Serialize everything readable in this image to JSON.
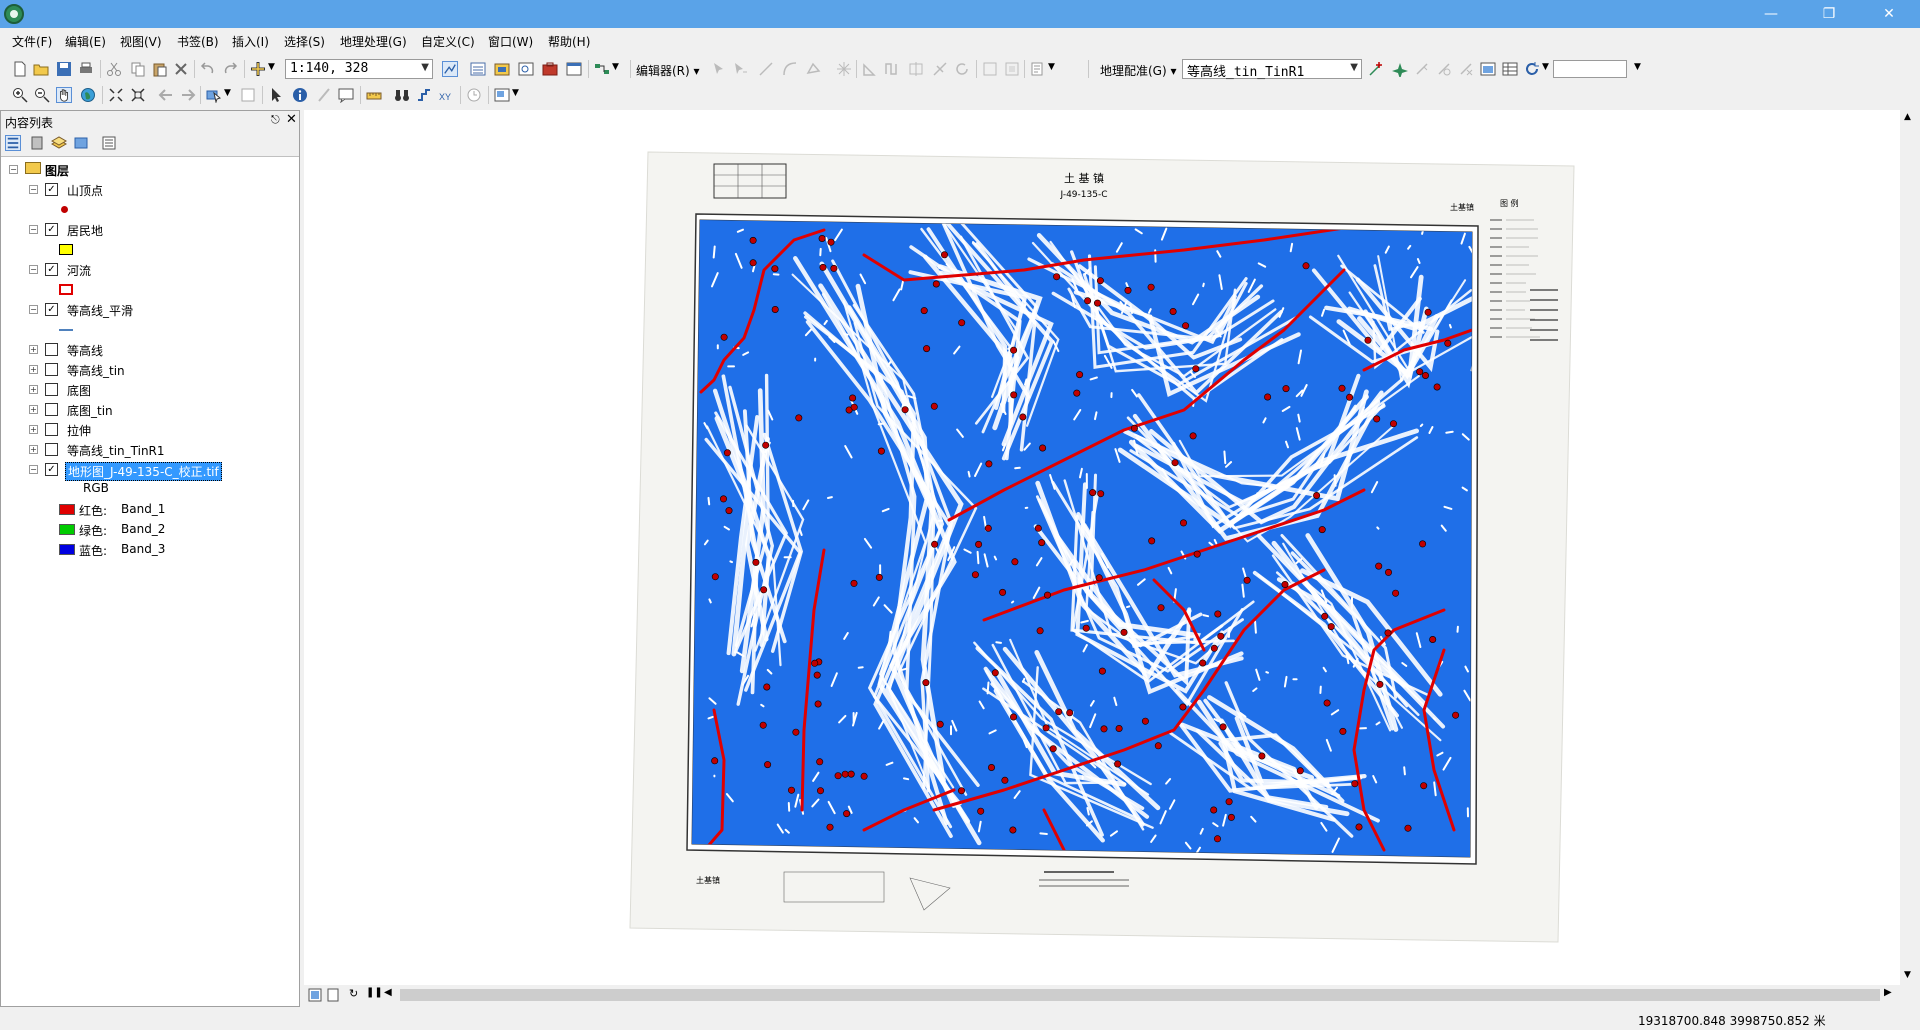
{
  "menu": [
    "文件(F)",
    "编辑(E)",
    "视图(V)",
    "书签(B)",
    "插入(I)",
    "选择(S)",
    "地理处理(G)",
    "自定义(C)",
    "窗口(W)",
    "帮助(H)"
  ],
  "toolbar": {
    "scale": "1:140, 328",
    "editor_label": "编辑器(R)",
    "georef_label": "地理配准(G)",
    "georef_layer": "等高线_tin_TinR1",
    "georef_value": ""
  },
  "toc": {
    "title": "内容列表",
    "root": "图层",
    "layers": [
      {
        "name": "山顶点",
        "checked": true,
        "expanded": true
      },
      {
        "name": "居民地",
        "checked": true,
        "expanded": true
      },
      {
        "name": "河流",
        "checked": true,
        "expanded": true
      },
      {
        "name": "等高线_平滑",
        "checked": true,
        "expanded": true
      },
      {
        "name": "等高线",
        "checked": false,
        "expanded": false
      },
      {
        "name": "等高线_tin",
        "checked": false,
        "expanded": false
      },
      {
        "name": "底图",
        "checked": false,
        "expanded": false
      },
      {
        "name": "底图_tin",
        "checked": false,
        "expanded": false
      },
      {
        "name": "拉伸",
        "checked": false,
        "expanded": false
      },
      {
        "name": "等高线_tin_TinR1",
        "checked": false,
        "expanded": false
      },
      {
        "name": "地形图_J-49-135-C_校正.tif",
        "checked": true,
        "expanded": true,
        "selected": true
      }
    ],
    "raster": {
      "label": "RGB",
      "bands": [
        {
          "channel": "红色:",
          "band": "Band_1",
          "color": "#e00000"
        },
        {
          "channel": "绿色:",
          "band": "Band_2",
          "color": "#00cc00"
        },
        {
          "channel": "蓝色:",
          "band": "Band_3",
          "color": "#0000e0"
        }
      ]
    },
    "symbols": {
      "peak_color": "#c00000",
      "settlement_fill": "#ffff00",
      "river_color": "#e00000",
      "contour_color": "#4f81bd"
    }
  },
  "map": {
    "title": "土 基 镇",
    "sheet_code": "J-49-135-C",
    "right_title": "土基镇",
    "legend_title": "图 例",
    "bottom_left_label": "土基镇",
    "water_color": "#1f6fe8"
  },
  "status": {
    "coordinates": "19318700.848  3998750.852 米"
  }
}
